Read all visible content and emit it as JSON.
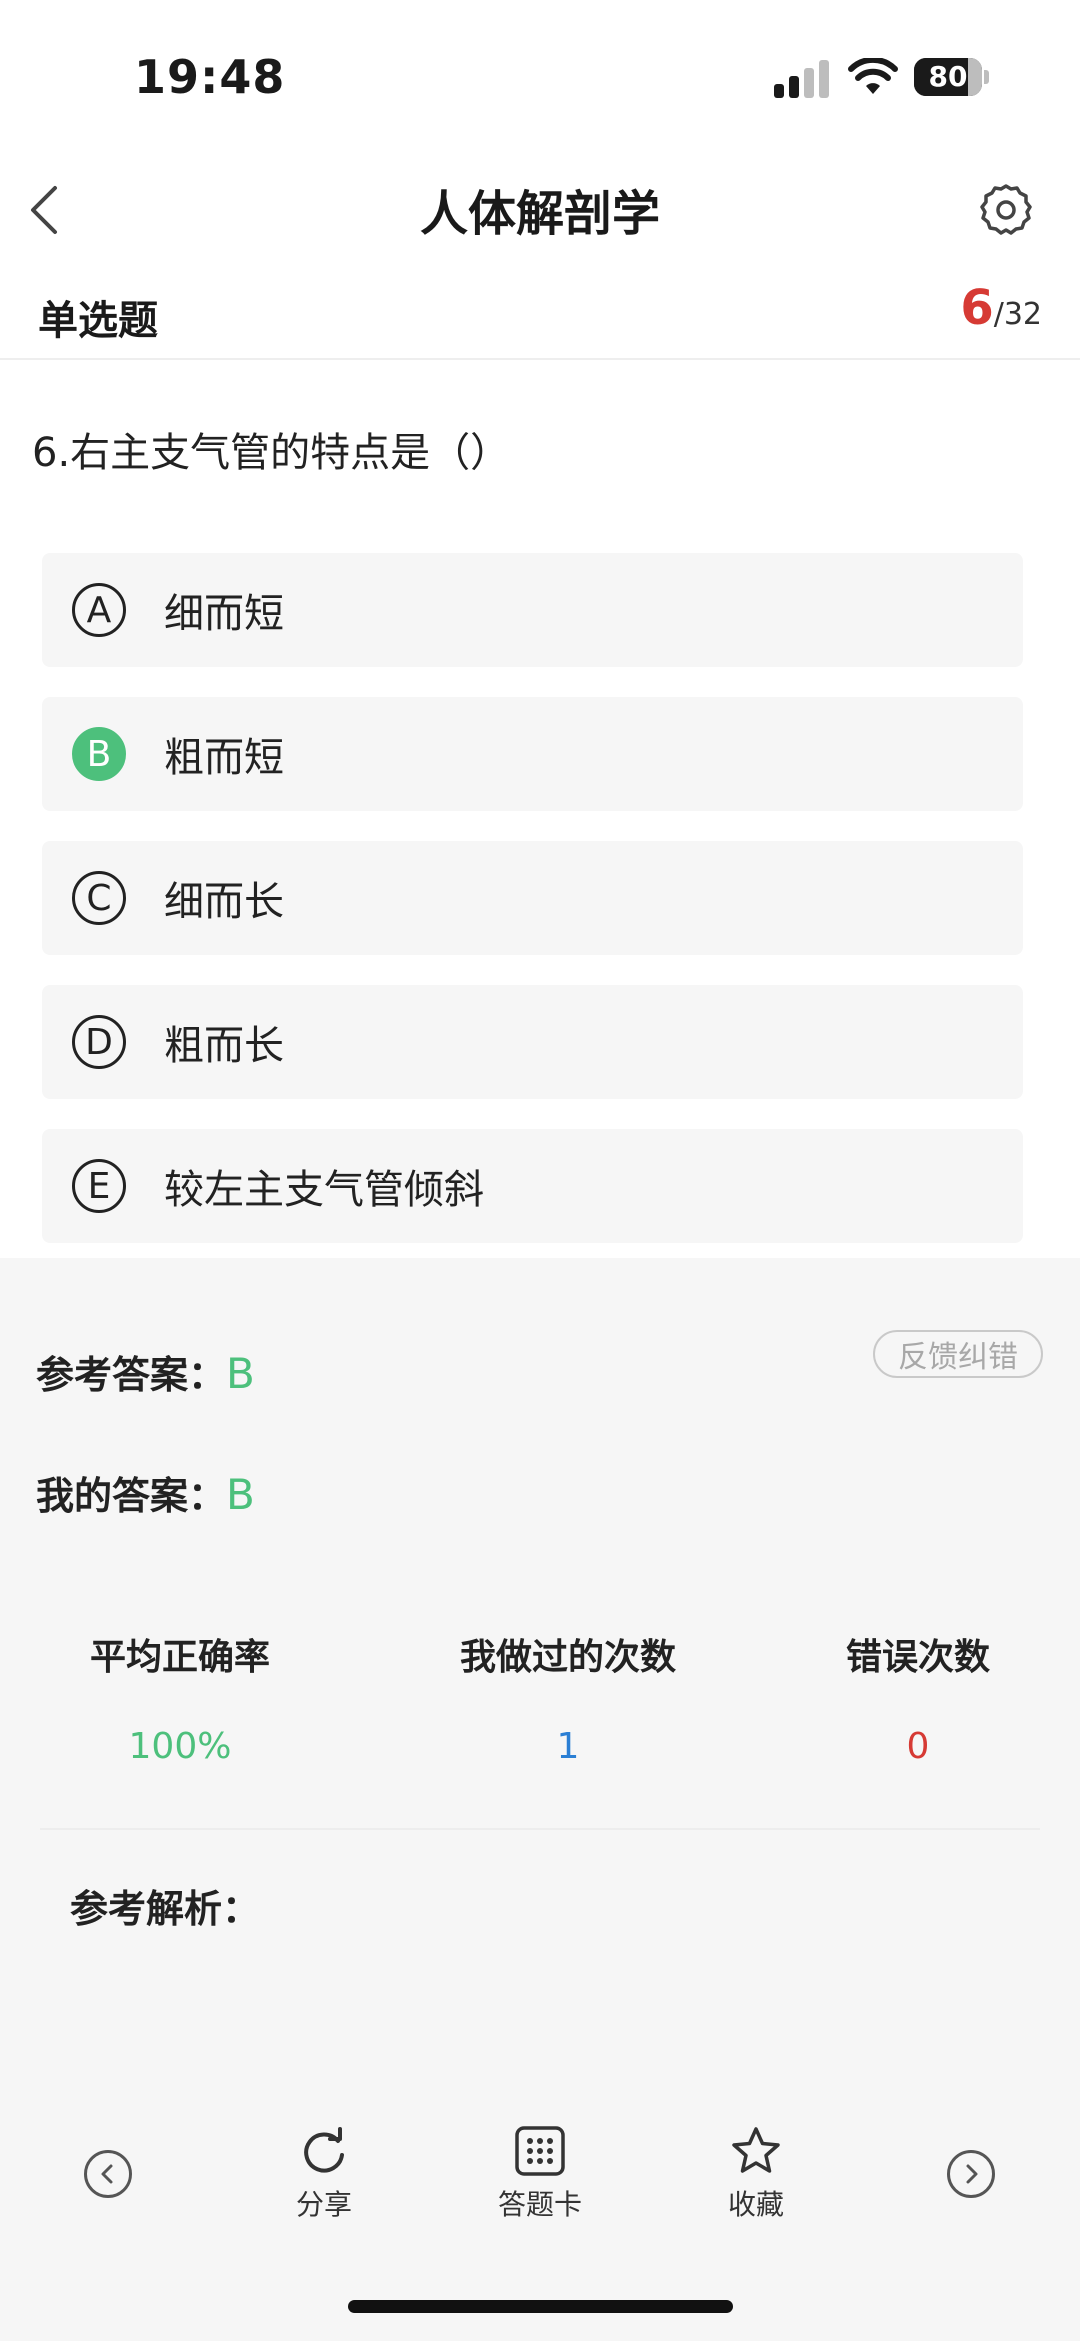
{
  "status_bar": {
    "time": "19:48",
    "battery": "80"
  },
  "nav": {
    "title": "人体解剖学"
  },
  "question_type": "单选题",
  "progress": {
    "current": "6",
    "total": "/32"
  },
  "question": "6.右主支气管的特点是（）",
  "options": [
    {
      "letter": "A",
      "text": "细而短"
    },
    {
      "letter": "B",
      "text": "粗而短"
    },
    {
      "letter": "C",
      "text": "细而长"
    },
    {
      "letter": "D",
      "text": "粗而长"
    },
    {
      "letter": "E",
      "text": "较左主支气管倾斜"
    }
  ],
  "selected_option": "B",
  "answer": {
    "reference_label": "参考答案：",
    "reference_value": "B",
    "mine_label": "我的答案：",
    "mine_value": "B",
    "feedback_label": "反馈纠错"
  },
  "stats": [
    {
      "label": "平均正确率",
      "value": "100%",
      "color": "#4dc07c"
    },
    {
      "label": "我做过的次数",
      "value": "1",
      "color": "#2b7fd4"
    },
    {
      "label": "错误次数",
      "value": "0",
      "color": "#d63a34"
    }
  ],
  "analysis_label": "参考解析：",
  "toolbar": {
    "share": "分享",
    "answer_card": "答题卡",
    "favorite": "收藏"
  },
  "colors": {
    "correct": "#4dc07c",
    "accent_red": "#d63a34",
    "accent_blue": "#2b7fd4"
  }
}
